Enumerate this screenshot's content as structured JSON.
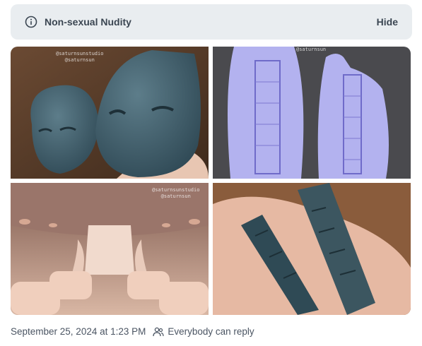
{
  "content_warning": {
    "icon": "info-icon",
    "label": "Non-sexual Nudity",
    "hide_label": "Hide"
  },
  "media": [
    {
      "watermark_line1": "@saturnsunstudio",
      "watermark_line2": "@saturnsun"
    },
    {
      "watermark_line1": "@saturnsun"
    },
    {
      "watermark_line1": "@saturnsunstudio",
      "watermark_line2": "@saturnsun"
    },
    {}
  ],
  "post_meta": {
    "timestamp": "September 25, 2024 at 1:23 PM",
    "reply_icon": "people-icon",
    "reply_setting": "Everybody can reply"
  }
}
